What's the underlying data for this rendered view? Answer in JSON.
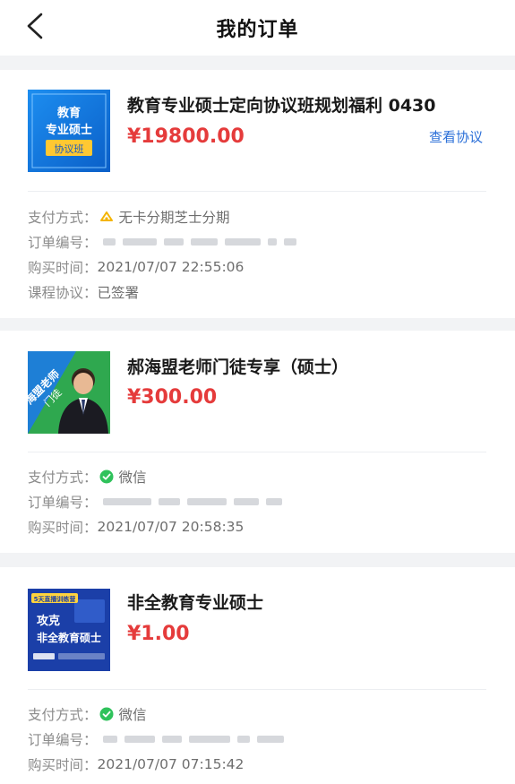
{
  "header": {
    "title": "我的订单"
  },
  "orders": [
    {
      "thumb_lines": [
        "教育",
        "专业硕士",
        "协议班"
      ],
      "name": "教育专业硕士定向协议班规划福利 0430",
      "price": "¥19800.00",
      "agreement_link": "查看协议",
      "pay_label": "支付方式：",
      "pay_method": "无卡分期芝士分期",
      "pay_icon": "installment-icon",
      "order_label": "订单编号：",
      "time_label": "购买时间：",
      "time": "2021/07/07 22:55:06",
      "agree_label": "课程协议：",
      "agree_status": "已签署"
    },
    {
      "thumb_lines": [
        "海盟老师",
        "门徒"
      ],
      "name": "郝海盟老师门徒专享（硕士）",
      "price": "¥300.00",
      "pay_label": "支付方式：",
      "pay_method": "微信",
      "pay_icon": "wechat-icon",
      "order_label": "订单编号：",
      "time_label": "购买时间：",
      "time": "2021/07/07 20:58:35"
    },
    {
      "thumb_lines": [
        "5天直播训练营",
        "攻克",
        "非全教育硕士"
      ],
      "name": "非全教育专业硕士",
      "price": "¥1.00",
      "pay_label": "支付方式：",
      "pay_method": "微信",
      "pay_icon": "wechat-icon",
      "order_label": "订单编号：",
      "time_label": "购买时间：",
      "time": "2021/07/07 07:15:42"
    }
  ],
  "colors": {
    "price": "#e53b3b",
    "link": "#2b6fd8",
    "wechat": "#2fc25b"
  }
}
